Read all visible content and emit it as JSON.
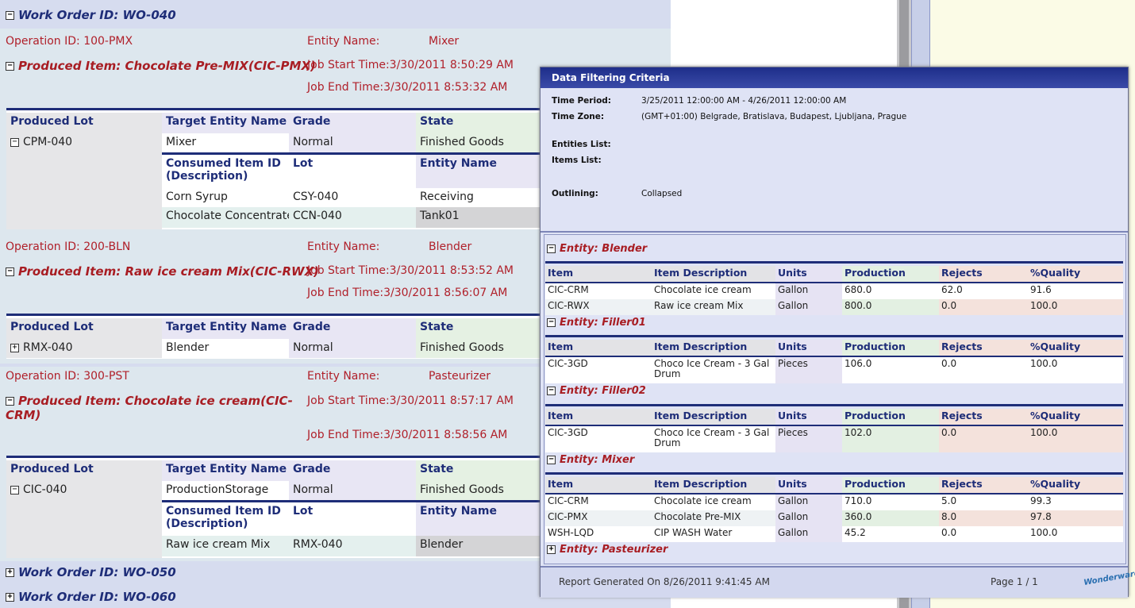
{
  "left": {
    "wo040": "Work Order ID: WO-040",
    "wo050": "Work Order ID: WO-050",
    "wo060": "Work Order ID: WO-060",
    "op1": {
      "op": "Operation ID: 100-PMX",
      "entity_label": "Entity Name:",
      "entity": "Mixer",
      "produced": "Produced Item: Chocolate Pre-MIX(CIC-PMX)",
      "start": "Job Start Time:3/30/2011 8:50:29 AM",
      "end": "Job End Time:3/30/2011 8:53:32 AM"
    },
    "op2": {
      "op": "Operation ID: 200-BLN",
      "entity_label": "Entity Name:",
      "entity": "Blender",
      "produced": "Produced Item: Raw ice cream Mix(CIC-RWX)",
      "start": "Job Start Time:3/30/2011 8:53:52 AM",
      "end": "Job End Time:3/30/2011 8:56:07 AM"
    },
    "op3": {
      "op": "Operation ID: 300-PST",
      "entity_label": "Entity Name:",
      "entity": "Pasteurizer",
      "produced": "Produced Item: Chocolate ice cream(CIC-",
      "produced2": "CRM)",
      "start": "Job Start Time:3/30/2011 8:57:17 AM",
      "end": "Job End Time:3/30/2011 8:58:56 AM"
    },
    "headers": {
      "lot": "Produced Lot",
      "target": "Target Entity Name",
      "grade": "Grade",
      "state": "State"
    },
    "sub_headers": {
      "consumed1": "Consumed Item ID",
      "consumed2": "(Description)",
      "lot": "Lot",
      "entity": "Entity Name"
    },
    "t1": {
      "lot": "CPM-040",
      "target": "Mixer",
      "grade": "Normal",
      "state": "Finished Goods",
      "rows": [
        [
          "Corn Syrup",
          "CSY-040",
          "Receiving"
        ],
        [
          "Chocolate Concentrate",
          "CCN-040",
          "Tank01"
        ]
      ]
    },
    "t2": {
      "lot": "RMX-040",
      "target": "Blender",
      "grade": "Normal",
      "state": "Finished Goods"
    },
    "t3": {
      "lot": "CIC-040",
      "target": "ProductionStorage",
      "grade": "Normal",
      "state": "Finished Goods",
      "rows": [
        [
          "Raw ice cream Mix",
          "RMX-040",
          "Blender"
        ]
      ]
    }
  },
  "popup": {
    "title": "Data Filtering Criteria",
    "time_period_label": "Time Period:",
    "time_period": "3/25/2011 12:00:00 AM - 4/26/2011 12:00:00 AM",
    "time_zone_label": "Time Zone:",
    "time_zone": "(GMT+01:00) Belgrade, Bratislava, Budapest, Ljubljana, Prague",
    "entities_label": "Entities List:",
    "items_label": "Items List:",
    "outlining_label": "Outlining:",
    "outlining": "Collapsed",
    "cols": {
      "item": "Item",
      "desc": "Item Description",
      "units": "Units",
      "prod": "Production",
      "rej": "Rejects",
      "qual": "%Quality"
    },
    "ent_blender": "Entity: Blender",
    "ent_filler01": "Entity: Filler01",
    "ent_filler02": "Entity: Filler02",
    "ent_mixer": "Entity: Mixer",
    "ent_pasteurizer": "Entity: Pasteurizer",
    "blender": [
      [
        "CIC-CRM",
        "Chocolate ice cream",
        "Gallon",
        "680.0",
        "62.0",
        "91.6"
      ],
      [
        "CIC-RWX",
        "Raw ice cream Mix",
        "Gallon",
        "800.0",
        "0.0",
        "100.0"
      ]
    ],
    "filler01": [
      [
        "CIC-3GD",
        "Choco Ice Cream - 3 Gal",
        "Drum",
        "Pieces",
        "106.0",
        "0.0",
        "100.0"
      ]
    ],
    "filler02": [
      [
        "CIC-3GD",
        "Choco Ice Cream - 3 Gal",
        "Drum",
        "Pieces",
        "102.0",
        "0.0",
        "100.0"
      ]
    ],
    "mixer": [
      [
        "CIC-CRM",
        "Chocolate ice cream",
        "Gallon",
        "710.0",
        "5.0",
        "99.3"
      ],
      [
        "CIC-PMX",
        "Chocolate Pre-MIX",
        "Gallon",
        "360.0",
        "8.0",
        "97.8"
      ],
      [
        "WSH-LQD",
        "CIP WASH Water",
        "Gallon",
        "45.2",
        "0.0",
        "100.0"
      ]
    ],
    "footer": "Report Generated On 8/26/2011 9:41:45 AM",
    "page": "Page 1 / 1",
    "logo": "Wonderware"
  },
  "icons": {
    "expand": "plus-box-icon",
    "collapse": "minus-box-icon"
  }
}
